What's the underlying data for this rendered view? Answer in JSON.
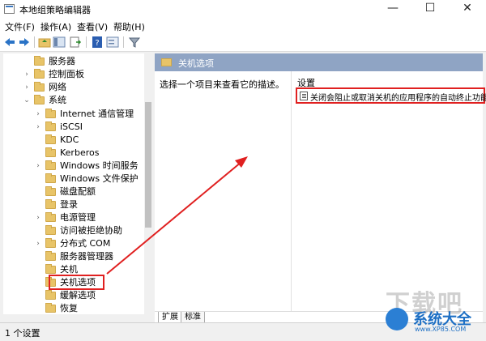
{
  "window": {
    "title": "本地组策略编辑器",
    "minimize": "—",
    "maximize": "☐",
    "close": "✕"
  },
  "menu": [
    "文件(F)",
    "操作(A)",
    "查看(V)",
    "帮助(H)"
  ],
  "tree": [
    {
      "label": "服务器",
      "arrow": ""
    },
    {
      "label": "控制面板",
      "arrow": "›"
    },
    {
      "label": "网络",
      "arrow": "›"
    },
    {
      "label": "系统",
      "arrow": "⌄"
    },
    {
      "label": "Internet 通信管理",
      "arrow": "›"
    },
    {
      "label": "iSCSI",
      "arrow": "›"
    },
    {
      "label": "KDC",
      "arrow": ""
    },
    {
      "label": "Kerberos",
      "arrow": ""
    },
    {
      "label": "Windows 时间服务",
      "arrow": "›"
    },
    {
      "label": "Windows 文件保护",
      "arrow": ""
    },
    {
      "label": "磁盘配额",
      "arrow": ""
    },
    {
      "label": "登录",
      "arrow": ""
    },
    {
      "label": "电源管理",
      "arrow": "›"
    },
    {
      "label": "访问被拒绝协助",
      "arrow": ""
    },
    {
      "label": "分布式 COM",
      "arrow": "›"
    },
    {
      "label": "服务器管理器",
      "arrow": ""
    },
    {
      "label": "关机",
      "arrow": ""
    },
    {
      "label": "关机选项",
      "arrow": ""
    },
    {
      "label": "缓解选项",
      "arrow": ""
    },
    {
      "label": "恢复",
      "arrow": ""
    }
  ],
  "right_panel": {
    "header": "关机选项",
    "description": "选择一个项目来查看它的描述。",
    "column_header": "设置",
    "setting": "关闭会阻止或取消关机的应用程序的自动终止功能"
  },
  "tabs": [
    "扩展",
    "标准"
  ],
  "status": "1 个设置",
  "watermark": {
    "big": "下载吧",
    "name": "系统大全",
    "url": "www.XP85.COM"
  },
  "colors": {
    "highlight": "#e02020",
    "header_bg": "#8fa4c4"
  }
}
